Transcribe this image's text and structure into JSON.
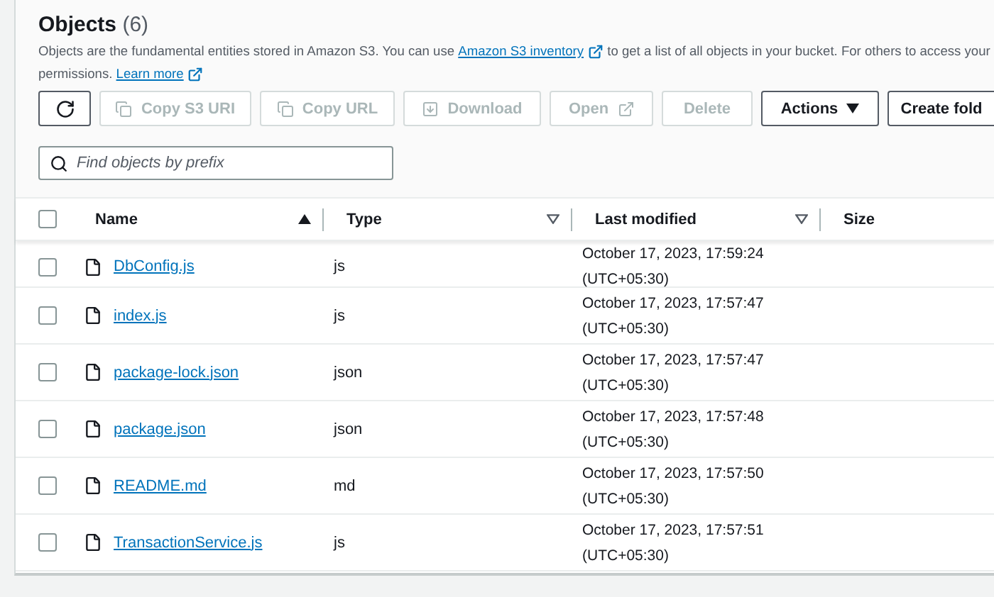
{
  "header": {
    "title": "Objects",
    "count": "(6)",
    "description_lines": [
      [
        {
          "kind": "text",
          "text": "Objects are the fundamental entities stored in Amazon S3. You can use"
        },
        {
          "kind": "link",
          "text": "Amazon S3 inventory",
          "external": true
        },
        {
          "kind": "text",
          "text": "to get a list of all objects in your bucket. For others to access your"
        }
      ],
      [
        {
          "kind": "text",
          "text": "permissions."
        },
        {
          "kind": "link",
          "text": "Learn more",
          "external": true
        }
      ]
    ]
  },
  "toolbar": [
    {
      "kind": "refresh",
      "disabled": false
    },
    {
      "kind": "copy",
      "label": "Copy S3 URI",
      "disabled": true
    },
    {
      "kind": "copy",
      "label": "Copy URL",
      "disabled": true
    },
    {
      "kind": "download",
      "label": "Download",
      "disabled": true
    },
    {
      "kind": "open",
      "label": "Open",
      "disabled": true
    },
    {
      "kind": "plain",
      "label": "Delete",
      "disabled": true
    },
    {
      "kind": "dropdown",
      "label": "Actions",
      "disabled": false
    },
    {
      "kind": "plain",
      "label": "Create fold",
      "disabled": false
    }
  ],
  "search": {
    "placeholder": "Find objects by prefix"
  },
  "table": {
    "select_all": {
      "checked": false
    },
    "columns": [
      {
        "label": "Name",
        "sorted": true
      },
      {
        "label": "Type",
        "sorted": false
      },
      {
        "label": "Last modified",
        "sorted": false
      },
      {
        "label": "Size"
      }
    ],
    "rows": [
      {
        "name": "DbConfig.js",
        "type": "js",
        "modified": "October 17, 2023, 17:59:24",
        "zone": "(UTC+05:30)",
        "checked": false
      },
      {
        "name": "index.js",
        "type": "js",
        "modified": "October 17, 2023, 17:57:47",
        "zone": "(UTC+05:30)",
        "checked": false
      },
      {
        "name": "package-lock.json",
        "type": "json",
        "modified": "October 17, 2023, 17:57:47",
        "zone": "(UTC+05:30)",
        "checked": false
      },
      {
        "name": "package.json",
        "type": "json",
        "modified": "October 17, 2023, 17:57:48",
        "zone": "(UTC+05:30)",
        "checked": false
      },
      {
        "name": "README.md",
        "type": "md",
        "modified": "October 17, 2023, 17:57:50",
        "zone": "(UTC+05:30)",
        "checked": false
      },
      {
        "name": "TransactionService.js",
        "type": "js",
        "modified": "October 17, 2023, 17:57:51",
        "zone": "(UTC+05:30)",
        "checked": false
      }
    ]
  }
}
